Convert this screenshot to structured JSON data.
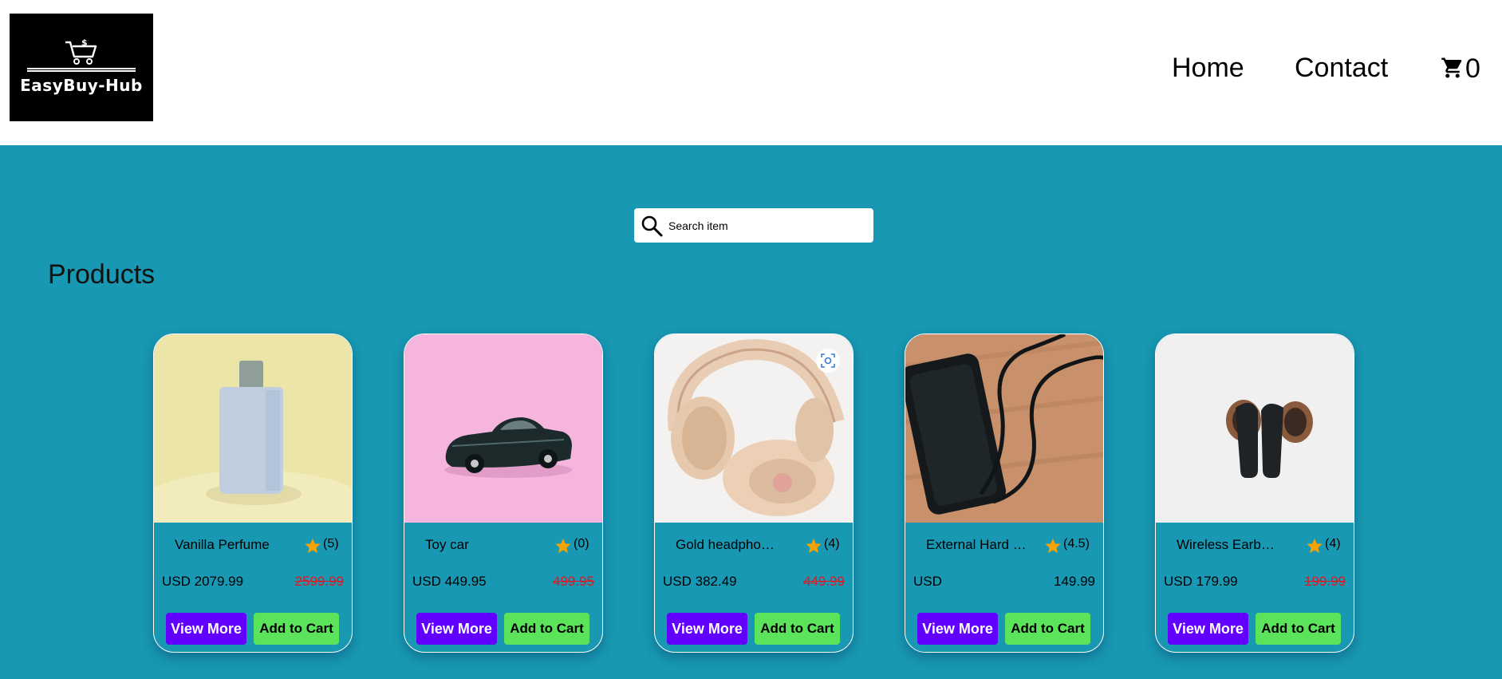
{
  "brand": {
    "name": "EasyBuy-Hub"
  },
  "nav": {
    "home": "Home",
    "contact": "Contact",
    "cart_count": "0"
  },
  "search": {
    "placeholder": "Search item"
  },
  "section": {
    "title": "Products"
  },
  "buttons": {
    "view_more": "View More",
    "add_to_cart": "Add to Cart"
  },
  "products": [
    {
      "name": "Vanilla Perfume",
      "rating": "(5)",
      "price": "USD 2079.99",
      "old_price": "2599.99"
    },
    {
      "name": "Toy car",
      "rating": "(0)",
      "price": "USD 449.95",
      "old_price": "499.95"
    },
    {
      "name": "Gold headphones",
      "rating": "(4)",
      "price": "USD 382.49",
      "old_price": "449.99"
    },
    {
      "name": "External Hard D...",
      "rating": "(4.5)",
      "price": "USD",
      "old_price": "149.99"
    },
    {
      "name": "Wireless Earbuds",
      "rating": "(4)",
      "price": "USD 179.99",
      "old_price": "199.99"
    }
  ],
  "icons": {
    "search": "search-icon",
    "cart": "cart-icon",
    "star": "star-icon",
    "lens": "lens-icon"
  },
  "colors": {
    "background": "#1898b3",
    "view_more": "#6200ff",
    "add_to_cart": "#5be45b",
    "strike_price": "#e8151d",
    "star": "#f5a300"
  }
}
